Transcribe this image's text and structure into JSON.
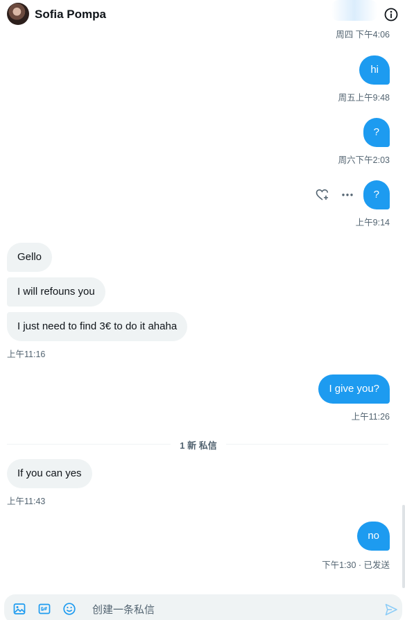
{
  "header": {
    "contact_name": "Sofia Pompa"
  },
  "thread": {
    "top_timestamp": "周四 下午4:06",
    "messages": [
      {
        "direction": "out",
        "text": "hi",
        "timestamp": "周五上午9:48"
      },
      {
        "direction": "out",
        "text": "?",
        "timestamp": "周六下午2:03"
      },
      {
        "direction": "out",
        "text": "?",
        "timestamp": "上午9:14"
      },
      {
        "direction": "in",
        "text": "Gello"
      },
      {
        "direction": "in",
        "text": "I will refouns you"
      },
      {
        "direction": "in",
        "text": "I just need to find 3€ to do it ahaha",
        "timestamp": "上午11:16"
      },
      {
        "direction": "out",
        "text": "I give you?",
        "timestamp": "上午11:26"
      },
      {
        "direction": "in",
        "text": "If you can yes",
        "timestamp": "上午11:43"
      },
      {
        "direction": "out",
        "text": "no",
        "timestamp": "下午1:30 · 已发送"
      }
    ],
    "new_messages_divider": "1 新 私信"
  },
  "composer": {
    "placeholder": "创建一条私信",
    "icons": [
      "image-icon",
      "gif-icon",
      "emoji-icon",
      "send-icon"
    ]
  },
  "colors": {
    "outgoing_bubble": "#1d9bf0",
    "incoming_bubble": "#eff3f4",
    "secondary_text": "#536471"
  }
}
